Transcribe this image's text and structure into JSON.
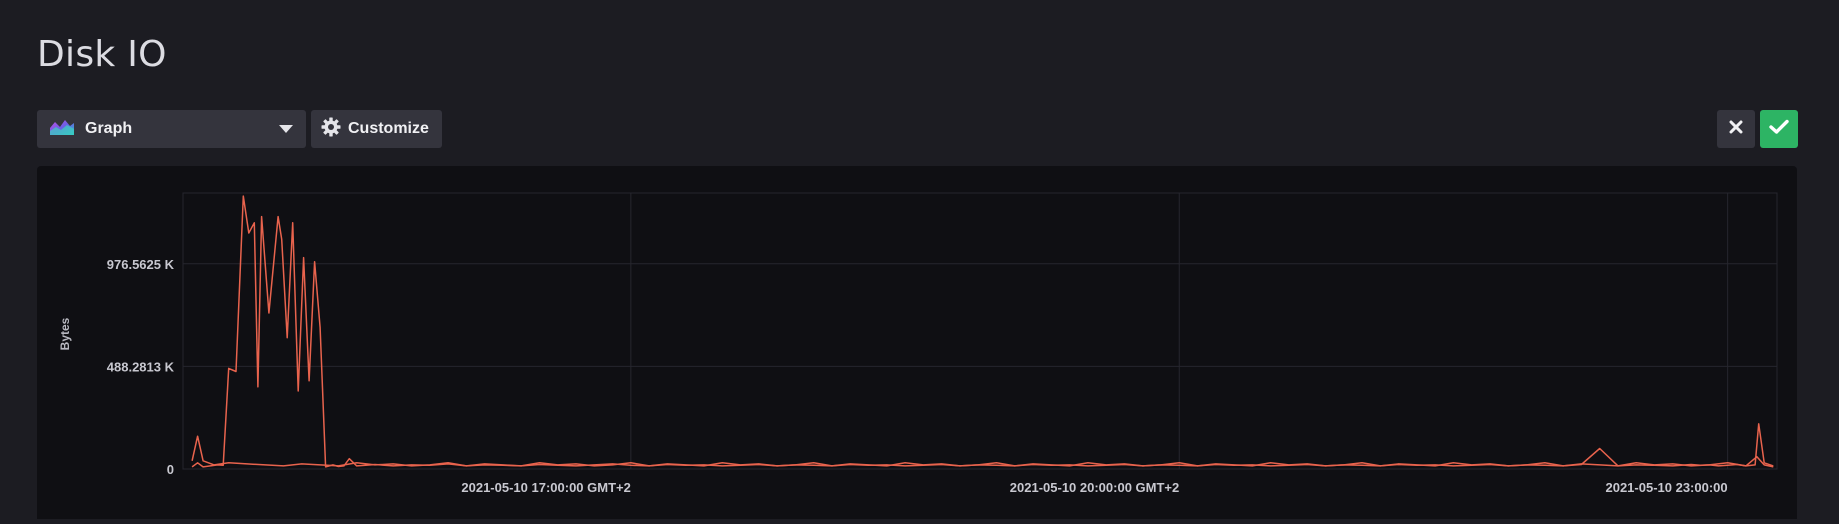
{
  "page": {
    "title": "Disk IO"
  },
  "toolbar": {
    "visualization_label": "Graph",
    "customize_label": "Customize"
  },
  "colors": {
    "accent": "#2db464",
    "series": "#e8634d",
    "background": "#1c1c22",
    "panel": "#0f0f13"
  },
  "chart_data": {
    "type": "line",
    "ylabel": "Bytes",
    "xlabel": "",
    "y_ticks": [
      "0",
      "488.2813 K",
      "976.5625 K"
    ],
    "y_tick_values": [
      0,
      500000,
      1000000
    ],
    "ylim": [
      0,
      1345000
    ],
    "x_ticks": [
      "2021-05-10 17:00:00 GMT+2",
      "2021-05-10 20:00:00 GMT+2",
      "2021-05-10 23:00:00"
    ],
    "x_tick_hours": [
      17,
      20,
      23
    ],
    "xlim_hours": [
      14.55,
      23.27
    ],
    "grid": true,
    "legend": "none",
    "series": [
      {
        "hours": [
          14.6,
          14.63,
          14.66,
          14.7,
          14.74,
          14.77,
          14.8,
          14.84,
          14.88,
          14.91,
          14.94,
          14.96,
          14.98,
          15.02,
          15.07,
          15.09,
          15.12,
          15.15,
          15.18,
          15.21,
          15.24,
          15.27,
          15.3,
          15.33,
          15.37,
          15.4,
          15.43,
          15.46,
          15.5,
          15.55,
          15.6,
          15.7,
          15.8,
          15.9,
          16.0,
          16.1,
          16.2,
          16.3,
          16.4,
          16.5,
          16.6,
          16.7,
          16.8,
          16.9,
          17.0,
          17.1,
          17.2,
          17.3,
          17.4,
          17.5,
          17.6,
          17.7,
          17.8,
          17.9,
          18.0,
          18.1,
          18.2,
          18.3,
          18.4,
          18.5,
          18.6,
          18.7,
          18.8,
          18.9,
          19.0,
          19.1,
          19.2,
          19.3,
          19.4,
          19.5,
          19.6,
          19.7,
          19.8,
          19.9,
          20.0,
          20.1,
          20.2,
          20.3,
          20.4,
          20.5,
          20.6,
          20.7,
          20.8,
          20.9,
          21.0,
          21.1,
          21.2,
          21.3,
          21.4,
          21.5,
          21.6,
          21.7,
          21.8,
          21.9,
          22.0,
          22.1,
          22.2,
          22.3,
          22.4,
          22.5,
          22.6,
          22.7,
          22.8,
          22.85,
          22.9,
          22.95,
          23.0,
          23.05,
          23.1,
          23.15,
          23.17,
          23.2,
          23.25
        ],
        "values": [
          10000,
          30000,
          10000,
          15000,
          20000,
          18000,
          490000,
          475000,
          1330000,
          1150000,
          1200000,
          400000,
          1230000,
          760000,
          1230000,
          1120000,
          640000,
          1200000,
          380000,
          1030000,
          430000,
          1010000,
          690000,
          10000,
          20000,
          12000,
          15000,
          50000,
          15000,
          18000,
          22000,
          15000,
          20000,
          18000,
          25000,
          15000,
          20000,
          18000,
          15000,
          22000,
          18000,
          15000,
          20000,
          25000,
          18000,
          15000,
          22000,
          18000,
          20000,
          15000,
          18000,
          22000,
          15000,
          20000,
          18000,
          15000,
          22000,
          18000,
          20000,
          15000,
          18000,
          22000,
          15000,
          20000,
          18000,
          15000,
          22000,
          18000,
          20000,
          15000,
          18000,
          22000,
          15000,
          20000,
          18000,
          15000,
          22000,
          18000,
          20000,
          15000,
          18000,
          22000,
          15000,
          20000,
          18000,
          15000,
          22000,
          18000,
          20000,
          15000,
          18000,
          22000,
          15000,
          20000,
          18000,
          15000,
          22000,
          100000,
          15000,
          20000,
          18000,
          15000,
          22000,
          18000,
          20000,
          15000,
          18000,
          22000,
          15000,
          20000,
          220000,
          30000,
          15000
        ]
      },
      {
        "hours": [
          14.6,
          14.63,
          14.66,
          14.72,
          14.8,
          14.9,
          15.0,
          15.1,
          15.2,
          15.3,
          15.4,
          15.5,
          15.6,
          15.7,
          15.8,
          15.9,
          16.0,
          16.1,
          16.2,
          16.3,
          16.4,
          16.5,
          16.6,
          16.7,
          16.8,
          16.9,
          17.0,
          17.1,
          17.2,
          17.3,
          17.4,
          17.5,
          17.6,
          17.7,
          17.8,
          17.9,
          18.0,
          18.1,
          18.2,
          18.3,
          18.4,
          18.5,
          18.6,
          18.7,
          18.8,
          18.9,
          19.0,
          19.1,
          19.2,
          19.3,
          19.4,
          19.5,
          19.6,
          19.7,
          19.8,
          19.9,
          20.0,
          20.1,
          20.2,
          20.3,
          20.4,
          20.5,
          20.6,
          20.7,
          20.8,
          20.9,
          21.0,
          21.1,
          21.2,
          21.3,
          21.4,
          21.5,
          21.6,
          21.7,
          21.8,
          21.9,
          22.0,
          22.1,
          22.2,
          22.3,
          22.4,
          22.5,
          22.6,
          22.7,
          22.8,
          22.9,
          23.0,
          23.1,
          23.16,
          23.2,
          23.25
        ],
        "values": [
          40000,
          160000,
          40000,
          20000,
          30000,
          25000,
          20000,
          15000,
          25000,
          20000,
          15000,
          30000,
          20000,
          25000,
          15000,
          20000,
          30000,
          15000,
          25000,
          20000,
          15000,
          30000,
          20000,
          25000,
          15000,
          20000,
          30000,
          15000,
          25000,
          20000,
          15000,
          30000,
          20000,
          25000,
          15000,
          20000,
          30000,
          15000,
          25000,
          20000,
          15000,
          30000,
          20000,
          25000,
          15000,
          20000,
          30000,
          15000,
          25000,
          20000,
          15000,
          30000,
          20000,
          25000,
          15000,
          20000,
          30000,
          15000,
          25000,
          20000,
          15000,
          30000,
          20000,
          25000,
          15000,
          20000,
          30000,
          15000,
          25000,
          20000,
          15000,
          30000,
          20000,
          25000,
          15000,
          20000,
          30000,
          15000,
          25000,
          20000,
          15000,
          30000,
          20000,
          25000,
          15000,
          20000,
          30000,
          15000,
          60000,
          20000,
          10000
        ]
      }
    ]
  }
}
